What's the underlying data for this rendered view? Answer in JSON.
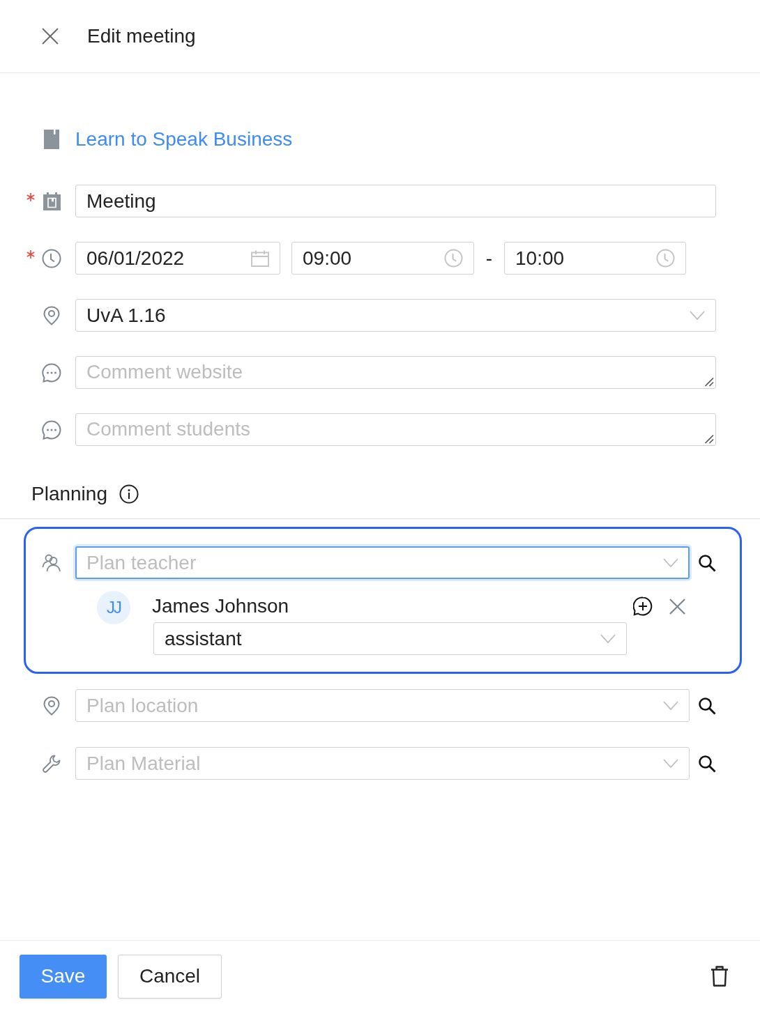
{
  "header": {
    "title": "Edit meeting"
  },
  "course": {
    "title": "Learn to Speak Business"
  },
  "fields": [
    {
      "kind": "text",
      "required": true,
      "value": "Meeting"
    },
    {
      "kind": "datetime",
      "required": true,
      "date": "06/01/2022",
      "start": "09:00",
      "separator": "-",
      "end": "10:00"
    },
    {
      "kind": "select",
      "required": false,
      "value": "UvA 1.16"
    },
    {
      "kind": "textarea",
      "required": false,
      "placeholder": "Comment website"
    },
    {
      "kind": "textarea",
      "required": false,
      "placeholder": "Comment students"
    }
  ],
  "planning": {
    "title": "Planning",
    "rows": [
      {
        "kind": "teacher",
        "placeholder": "Plan teacher",
        "focused": true,
        "highlighted": true,
        "assigned": [
          {
            "initials": "JJ",
            "name": "James Johnson",
            "role": "assistant"
          }
        ]
      },
      {
        "kind": "location",
        "placeholder": "Plan location",
        "focused": false,
        "highlighted": false
      },
      {
        "kind": "material",
        "placeholder": "Plan Material",
        "focused": false,
        "highlighted": false
      }
    ]
  },
  "footer": {
    "buttons": [
      {
        "kind": "primary",
        "label": "Save"
      },
      {
        "kind": "secondary",
        "label": "Cancel"
      }
    ]
  }
}
